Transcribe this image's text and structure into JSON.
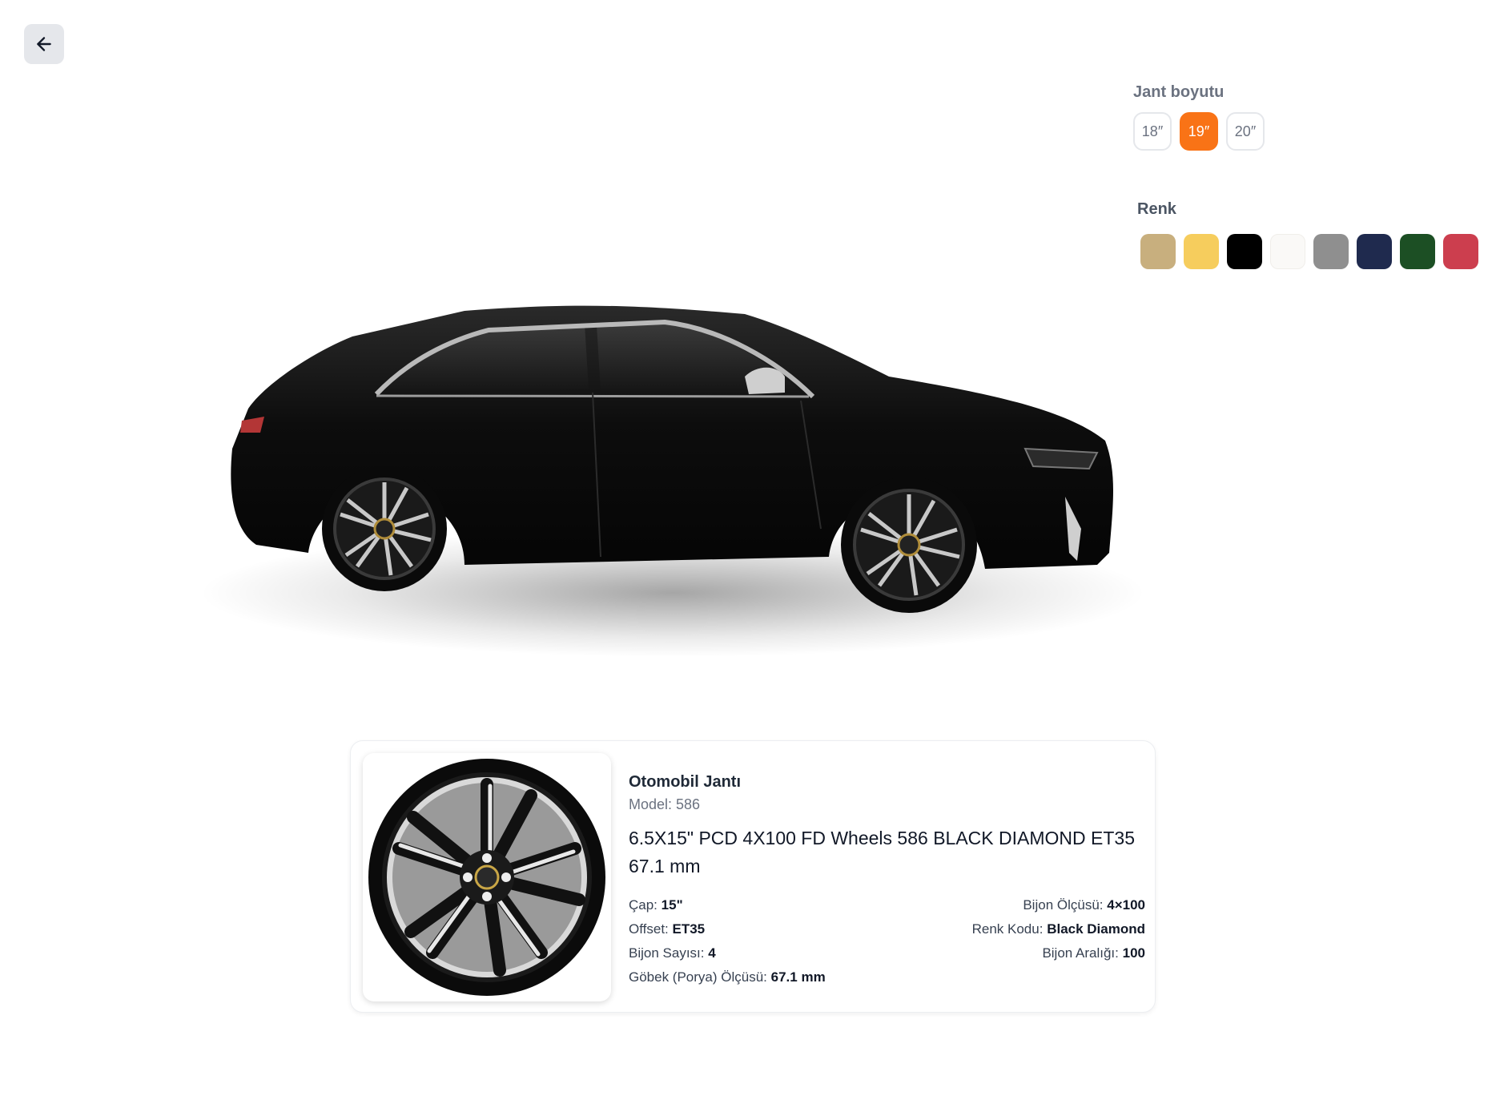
{
  "nav": {
    "back_icon": "arrow-left-icon"
  },
  "options": {
    "size_label": "Jant boyutu",
    "sizes": [
      {
        "label": "18″",
        "active": false
      },
      {
        "label": "19″",
        "active": true
      },
      {
        "label": "20″",
        "active": false
      }
    ],
    "color_label": "Renk",
    "colors": [
      "#c8af7e",
      "#f6cd5d",
      "#000000",
      "#faf9f7",
      "#8f8f8f",
      "#1f2a4e",
      "#1c4f24",
      "#cc3e4e"
    ],
    "accent_color": "#f97316"
  },
  "product": {
    "category": "Otomobil Jantı",
    "model": "Model: 586",
    "title": "6.5X15\" PCD 4X100 FD Wheels 586 BLACK DIAMOND ET35 67.1 mm",
    "specs_left": [
      {
        "label": "Çap:",
        "value": "15\""
      },
      {
        "label": "Offset:",
        "value": "ET35"
      },
      {
        "label": "Bijon Sayısı:",
        "value": "4"
      },
      {
        "label": "Göbek (Porya) Ölçüsü:",
        "value": "67.1 mm"
      }
    ],
    "specs_right": [
      {
        "label": "Bijon Ölçüsü:",
        "value": "4×100"
      },
      {
        "label": "Renk Kodu:",
        "value": "Black Diamond"
      },
      {
        "label": "Bijon Aralığı:",
        "value": "100"
      }
    ]
  }
}
